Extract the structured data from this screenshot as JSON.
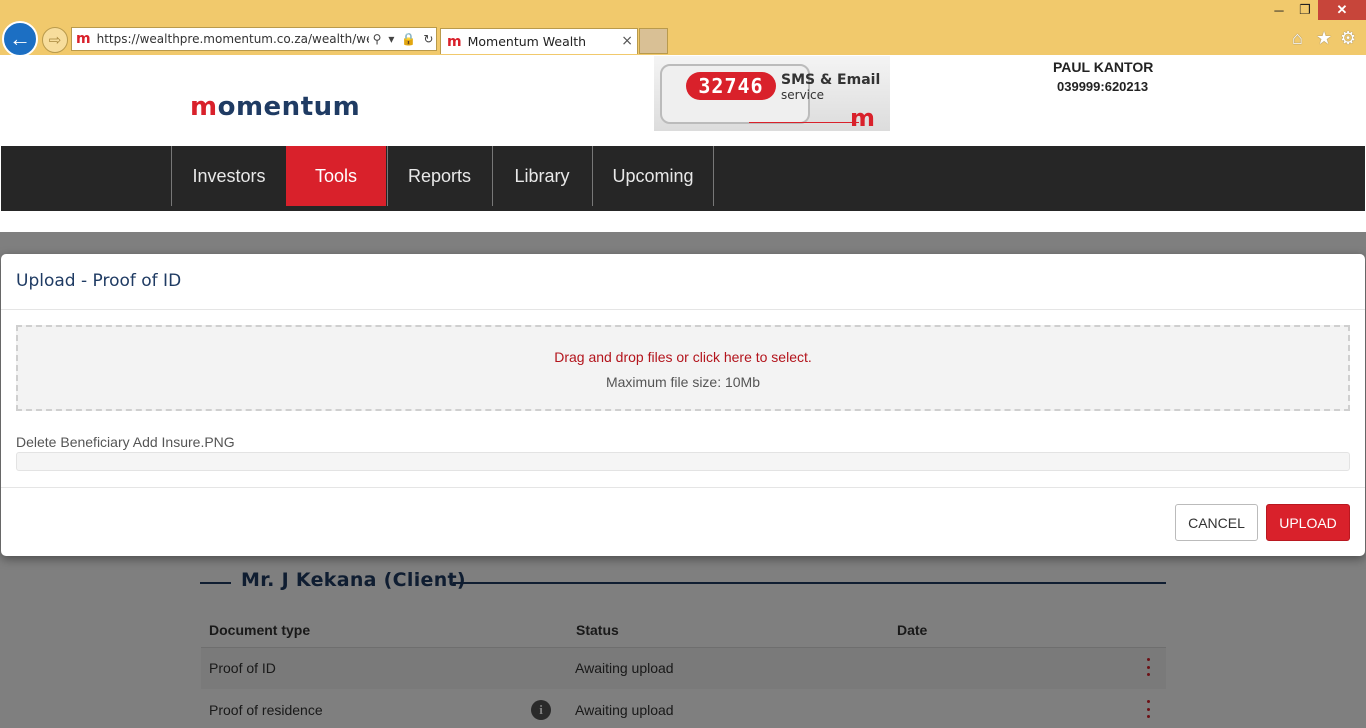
{
  "browser": {
    "url": "https://wealthpre.momentum.co.za/wealth/wealth",
    "tab_title": "Momentum Wealth",
    "close_glyph": "×"
  },
  "header": {
    "logo_text": "momentum",
    "banner": {
      "number": "32746",
      "title": "SMS & Email",
      "subtitle": "service"
    },
    "user_name": "PAUL KANTOR",
    "user_code": "039999:620213"
  },
  "nav": {
    "items": [
      {
        "label": "Investors",
        "active": false
      },
      {
        "label": "Tools",
        "active": true
      },
      {
        "label": "Reports",
        "active": false
      },
      {
        "label": "Library",
        "active": false
      },
      {
        "label": "Upcoming",
        "active": false
      }
    ]
  },
  "modal": {
    "title": "Upload - Proof of ID",
    "dropzone_message": "Drag and drop files or click here to select.",
    "dropzone_limit": "Maximum file size: 10Mb",
    "file_name": "Delete Beneficiary Add Insure.PNG",
    "progress": 0,
    "cancel_label": "CANCEL",
    "upload_label": "UPLOAD"
  },
  "client_section": {
    "title": "Mr. J Kekana (Client)",
    "columns": [
      "Document type",
      "Status",
      "Date"
    ],
    "rows": [
      {
        "document_type": "Proof of ID",
        "status": "Awaiting upload",
        "date": ""
      },
      {
        "document_type": "Proof of residence",
        "status": "Awaiting upload",
        "date": ""
      }
    ]
  },
  "icons": {
    "back": "arrow-left-icon",
    "forward": "arrow-right-icon",
    "search": "search-icon",
    "lock": "lock-icon",
    "refresh": "refresh-icon",
    "home": "home-icon",
    "favorites": "star-icon",
    "tools": "gear-icon",
    "row_menu": "kebab-menu-icon",
    "info": "info-icon"
  },
  "colors": {
    "brand_red": "#d9212b",
    "brand_navy": "#1f3b63",
    "nav_bg": "#262626",
    "chrome_bg": "#f1c96c"
  }
}
